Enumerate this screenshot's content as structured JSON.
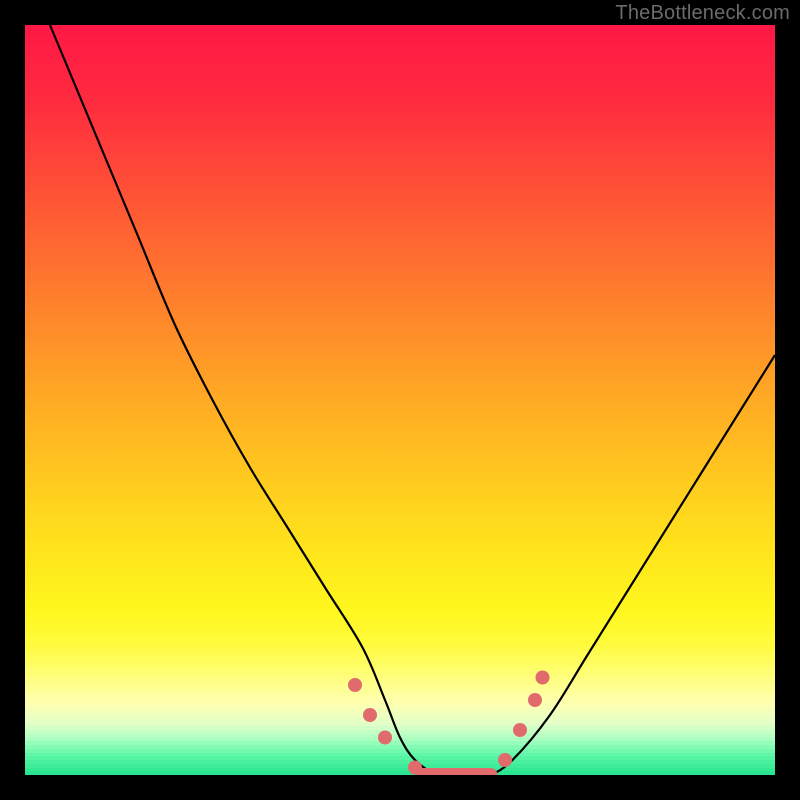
{
  "watermark": "TheBottleneck.com",
  "chart_data": {
    "type": "line",
    "title": "",
    "xlabel": "",
    "ylabel": "",
    "xlim": [
      0,
      100
    ],
    "ylim": [
      0,
      100
    ],
    "x": [
      0,
      5,
      10,
      15,
      20,
      25,
      30,
      35,
      40,
      45,
      48,
      50,
      52,
      55,
      58,
      60,
      62,
      65,
      70,
      75,
      80,
      85,
      90,
      95,
      100
    ],
    "values": [
      108,
      96,
      84,
      72,
      60,
      50,
      41,
      33,
      25,
      17,
      10,
      5,
      2,
      0,
      0,
      0,
      0,
      2,
      8,
      16,
      24,
      32,
      40,
      48,
      56
    ],
    "annotations": [
      {
        "x": 44,
        "y": 12,
        "marker": "dot"
      },
      {
        "x": 46,
        "y": 8,
        "marker": "dot"
      },
      {
        "x": 48,
        "y": 5,
        "marker": "dot"
      },
      {
        "x": 52,
        "y": 1,
        "marker": "dot"
      },
      {
        "x": 55,
        "y": 0,
        "marker": "dot"
      },
      {
        "x": 58,
        "y": 0,
        "marker": "dot"
      },
      {
        "x": 61,
        "y": 0,
        "marker": "dot"
      },
      {
        "x": 64,
        "y": 2,
        "marker": "dot"
      },
      {
        "x": 66,
        "y": 6,
        "marker": "dot"
      },
      {
        "x": 68,
        "y": 10,
        "marker": "dot"
      },
      {
        "x": 69,
        "y": 13,
        "marker": "dot"
      }
    ],
    "gradient_stops": [
      {
        "pos": 0.0,
        "color": "#ff1846"
      },
      {
        "pos": 0.1,
        "color": "#ff2b3f"
      },
      {
        "pos": 0.2,
        "color": "#ff4a38"
      },
      {
        "pos": 0.3,
        "color": "#ff6a31"
      },
      {
        "pos": 0.4,
        "color": "#ff8a2a"
      },
      {
        "pos": 0.5,
        "color": "#ffaa24"
      },
      {
        "pos": 0.6,
        "color": "#ffc81f"
      },
      {
        "pos": 0.7,
        "color": "#ffe41c"
      },
      {
        "pos": 0.78,
        "color": "#fff71e"
      },
      {
        "pos": 0.82,
        "color": "#fffb3a"
      },
      {
        "pos": 0.86,
        "color": "#fffe72"
      },
      {
        "pos": 0.9,
        "color": "#ffffb0"
      },
      {
        "pos": 0.93,
        "color": "#e0ffc8"
      },
      {
        "pos": 0.95,
        "color": "#a8ffc0"
      },
      {
        "pos": 0.97,
        "color": "#60f7a8"
      },
      {
        "pos": 1.0,
        "color": "#1fe28a"
      }
    ],
    "marker_color": "#e16a6c",
    "curve_color": "#000000"
  }
}
